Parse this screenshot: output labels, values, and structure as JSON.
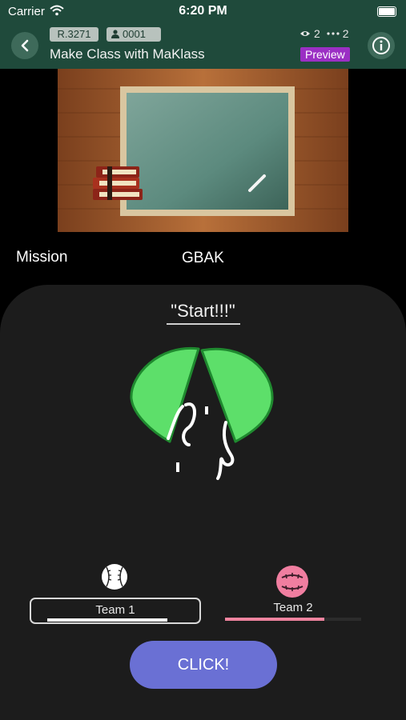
{
  "status_bar": {
    "carrier": "Carrier",
    "time": "6:20 PM"
  },
  "header": {
    "room_tag": "R.3271",
    "user_tag": "0001",
    "title": "Make Class with MaKlass",
    "views": "2",
    "participants": "2",
    "preview_label": "Preview"
  },
  "mission": {
    "label": "Mission",
    "value": "GBAK"
  },
  "game": {
    "start_text": "\"Start!!!\"",
    "team1": {
      "name": "Team 1",
      "progress": 0.7
    },
    "team2": {
      "name": "Team 2",
      "progress": 0.73
    },
    "click_label": "CLICK!"
  },
  "colors": {
    "header_bg": "#1f4a3b",
    "preview_badge": "#9b2fc4",
    "panel_bg": "#1c1c1c",
    "cookie_green": "#5ddf6a",
    "team2_pink": "#f0849f",
    "click_button": "#6a70d4"
  },
  "icons": [
    "back-chevron-icon",
    "wifi-icon",
    "battery-icon",
    "person-icon",
    "eye-icon",
    "dots-icon",
    "info-icon",
    "baseball-icon",
    "pink-ball-icon",
    "fortune-cookie"
  ]
}
